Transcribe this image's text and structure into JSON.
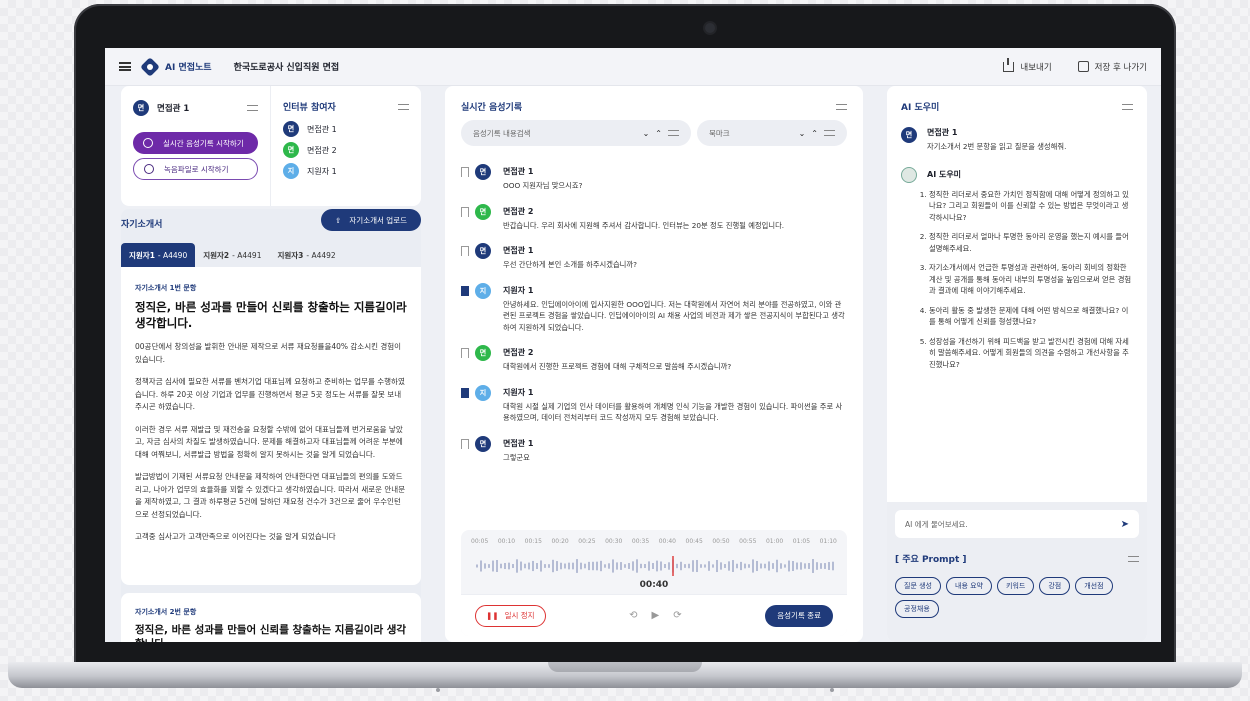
{
  "app": {
    "brand": "AI 면접노트",
    "title": "한국도로공사 신입직원 면접"
  },
  "topbar": {
    "export": "내보내기",
    "save_exit": "저장 후 나가기"
  },
  "interviewer": {
    "avatar": "면",
    "name": "면접관 1",
    "rec_start": "실시간 음성기록 시작하기",
    "file_start": "녹음파일로 시작하기"
  },
  "participants": {
    "title": "인터뷰 참여자",
    "items": [
      {
        "avatar": "면",
        "name": "면접관 1",
        "color": "#1f3a7a"
      },
      {
        "avatar": "면",
        "name": "면접관 2",
        "color": "#2eb84b"
      },
      {
        "avatar": "지",
        "name": "지원자 1",
        "color": "#5eaee8"
      }
    ]
  },
  "essay": {
    "title": "자기소개서",
    "upload": "자기소개서 업로드",
    "tabs": [
      {
        "name": "지원자1",
        "code": "- A4490"
      },
      {
        "name": "지원자2",
        "code": "- A4491"
      },
      {
        "name": "지원자3",
        "code": "- A4492"
      }
    ],
    "q1_label": "자기소개서 1번 문항",
    "q1_title": "정직은, 바른 성과를 만들어 신뢰를 창출하는 지름길이라 생각합니다.",
    "paragraphs": [
      "00공단에서 창의성을 발휘한 안내문 제작으로 서류 재요청률을40% 감소시킨 경험이 있습니다.",
      "정책자금 심사에 필요한 서류를 벤처기업 대표님께 요청하고 준비하는 업무를 수행하였습니다. 하루 20곳 이상 기업과 업무를 진행하면서 평균 5곳 정도는 서류를 잘못 보내주시곤 하였습니다.",
      "이러한 경우 서류 재발급 및 재전송을 요청할 수밖에 없어 대표님들께 번거로움을 낳았고, 자금 심사의 차질도 발생하였습니다. 문제를 해결하고자 대표님들께 어려운 부분에 대해 여쭤보니, 서류발급 방법을 정확히 알지 못하시는 것을 알게 되었습니다.",
      "발급방법이 기재된 서류요청 안내문을 제작하여 안내한다면 대표님들의 편의를 도와드리고, 나아가 업무의 효율화를 꾀할 수 있겠다고 생각하였습니다. 따라서 새로운 안내문을 제작하였고, 그 결과 하루평균 5건에 달하던 재요청 건수가 3건으로 줄어 우수인턴으로 선정되었습니다.",
      "고객중 심사고가 고객만족으로 이어진다는 것을 알게 되었습니다"
    ],
    "q2_label": "자기소개서 2번 문항",
    "q2_title": "정직은, 바른 성과를 만들어 신뢰를 창출하는 지름길이라 생각합니다."
  },
  "transcript": {
    "title": "실시간 음성기록",
    "search_placeholder": "음성기록 내용검색",
    "bookmark": "북마크",
    "messages": [
      {
        "avatar": "면",
        "color": "#1f3a7a",
        "name": "면접관 1",
        "text": "OOO 지원자님 맞으시죠?",
        "bookmarked": false
      },
      {
        "avatar": "면",
        "color": "#2eb84b",
        "name": "면접관 2",
        "text": "반갑습니다. 우리 회사에 지원해 주셔서 감사합니다. 인터뷰는 20분 정도 진행될 예정입니다.",
        "bookmarked": false
      },
      {
        "avatar": "면",
        "color": "#1f3a7a",
        "name": "면접관 1",
        "text": "우선 간단하게 본인 소개를 하주시겠습니까?",
        "bookmarked": false
      },
      {
        "avatar": "지",
        "color": "#5eaee8",
        "name": "지원자 1",
        "text": "안녕하세요. 인딥에이아이에 입사지원한 OOO입니다. 저는 대학원에서 자연어 처리 분야를 전공하였고, 이와 관련된 프로젝트 경험을 쌓았습니다. 인딥에이아이의 AI 채용 사업의 비전과 제가 쌓은 전공지식이 부합된다고 생각하여 지원하게 되었습니다.",
        "bookmarked": true
      },
      {
        "avatar": "면",
        "color": "#2eb84b",
        "name": "면접관 2",
        "text": "대학원에서 진행한 프로젝트 경험에 대해 구체적으로 말씀해 주시겠습니까?",
        "bookmarked": false
      },
      {
        "avatar": "지",
        "color": "#5eaee8",
        "name": "지원자 1",
        "text": "대학원 시절 실제 기업의 인사 데이터를 활용하여 개체명 인식 기능을 개발한 경험이 있습니다. 파이썬을 주로 사용하였으며, 데이터 전처리부터 코드 작성까지 모두 경험해 보았습니다.",
        "bookmarked": true
      },
      {
        "avatar": "면",
        "color": "#1f3a7a",
        "name": "면접관 1",
        "text": "그렇군요",
        "bookmarked": false
      }
    ],
    "ticks": [
      "00:05",
      "00:10",
      "00:15",
      "00:20",
      "00:25",
      "00:30",
      "00:35",
      "00:40",
      "00:45",
      "00:50",
      "00:55",
      "01:00",
      "01:05",
      "01:10"
    ],
    "current_time": "00:40",
    "progress": 0.55,
    "pause": "일시 정지",
    "end": "음성기록 종료"
  },
  "ai": {
    "title": "AI 도우미",
    "q_avatar": "면",
    "q_name": "면접관 1",
    "q_text": "자기소개서 2번 문항을 읽고 질문을 생성해줘.",
    "bot_name": "AI 도우미",
    "answers": [
      "정직한 리더로서 중요한 가치인 정직함에 대해 어떻게 정의하고 있나요? 그리고 회원들이 이를 신뢰할 수 있는 방법은 무엇이라고 생각하시나요?",
      "정직한 리더로서 얼마나 투명한 동아리 운영을 했는지 예시를 들어 설명해주세요.",
      "자기소개서에서 언급한 투명성과 관련하여, 동아리 회비의 정확한 계산 및 공개를 통해 동아리 내부의 투명성을 높임으로써 얻은 경험과 결과에 대해 이야기해주세요.",
      "동아리 활동 중 발생한 문제에 대해 어떤 방식으로 해결했나요? 이를 통해 어떻게 신뢰를 형성했나요?",
      "성장성을 개선하기 위해 피드백을 받고 발전시킨 경험에 대해 자세히 말씀해주세요. 어떻게 회원들의 의견을 수렴하고 개선사항을 추진했나요?"
    ],
    "input_placeholder": "AI 에게 물어보세요.",
    "prompt_title": "[ 주요 Prompt ]",
    "chips": [
      "질문 생성",
      "내용 요약",
      "키워드",
      "강점",
      "개선점",
      "공정채용"
    ]
  }
}
